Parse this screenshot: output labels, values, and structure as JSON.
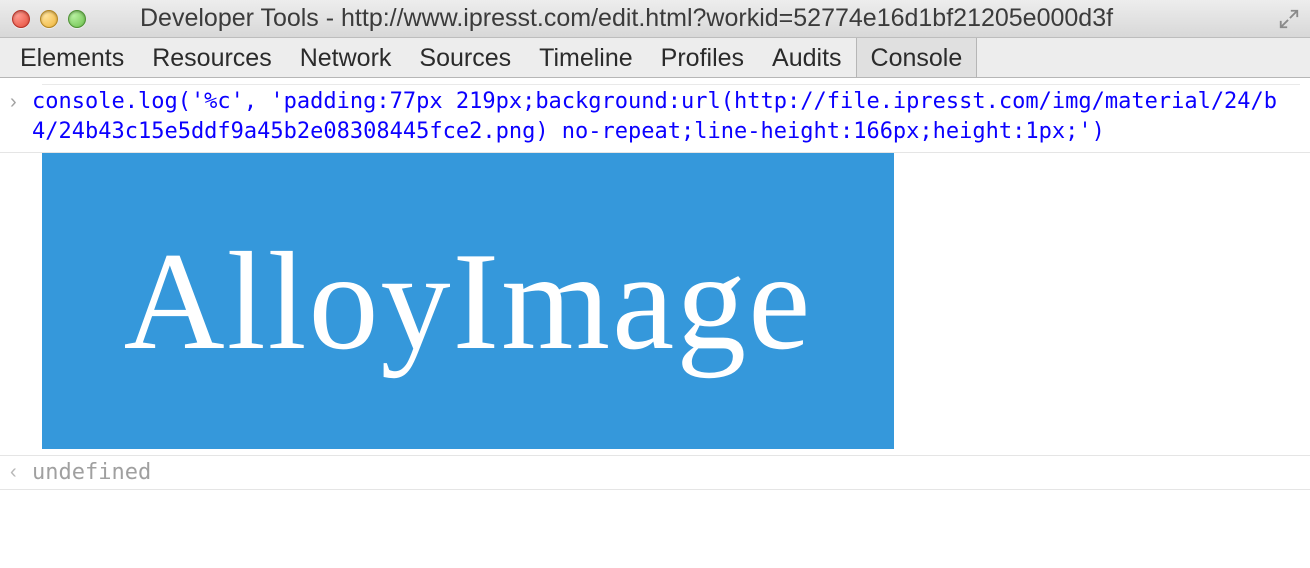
{
  "window": {
    "title": "Developer Tools - http://www.ipresst.com/edit.html?workid=52774e16d1bf21205e000d3f"
  },
  "tabs": {
    "items": [
      {
        "label": "Elements"
      },
      {
        "label": "Resources"
      },
      {
        "label": "Network"
      },
      {
        "label": "Sources"
      },
      {
        "label": "Timeline"
      },
      {
        "label": "Profiles"
      },
      {
        "label": "Audits"
      },
      {
        "label": "Console"
      }
    ],
    "active": "Console"
  },
  "console": {
    "input": "console.log('%c', 'padding:77px 219px;background:url(http://file.ipresst.com/img/material/24/b4/24b43c15e5ddf9a45b2e08308445fce2.png) no-repeat;line-height:166px;height:1px;')",
    "image_text": "AlloyImage",
    "output": "undefined"
  }
}
